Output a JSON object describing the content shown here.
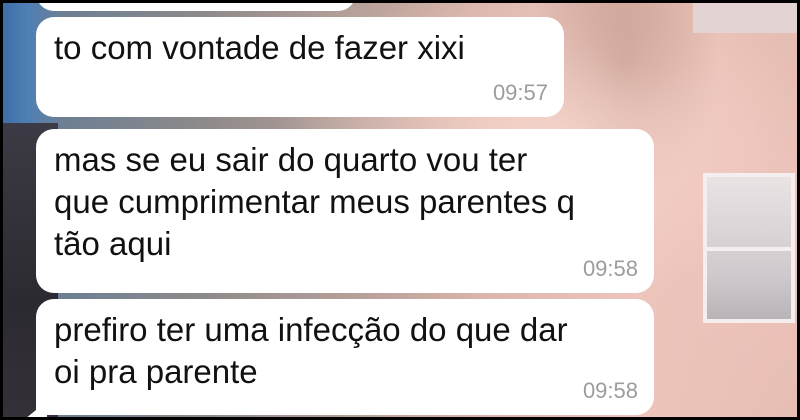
{
  "messages": [
    {
      "text": "to com vontade de fazer xixi",
      "time": "09:57"
    },
    {
      "text": "mas se eu sair do quarto vou ter\nque cumprimentar meus parentes q\ntão aqui",
      "time": "09:58"
    },
    {
      "text": "prefiro ter uma infecção do que dar\noi pra parente",
      "time": "09:58"
    }
  ]
}
